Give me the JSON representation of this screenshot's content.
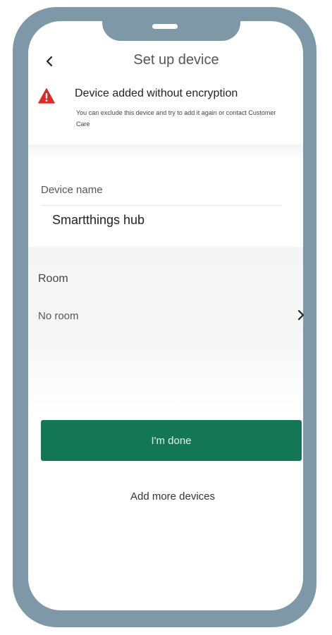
{
  "header": {
    "title": "Set up device"
  },
  "warning": {
    "title": "Device added without encryption",
    "body": "You can exclude this device and try to add it again or contact Customer Care"
  },
  "device_name": {
    "label": "Device name",
    "value": "Smartthings hub"
  },
  "room": {
    "label": "Room",
    "value": "No room"
  },
  "actions": {
    "done_label": "I'm done",
    "add_more_label": "Add more devices"
  },
  "colors": {
    "frame": "#7f98a8",
    "primary_button": "#137654",
    "warning": "#d92b2b"
  },
  "icons": {
    "back": "chevron-left-icon",
    "warning": "warning-triangle-icon",
    "room_chevron": "chevron-right-icon"
  }
}
